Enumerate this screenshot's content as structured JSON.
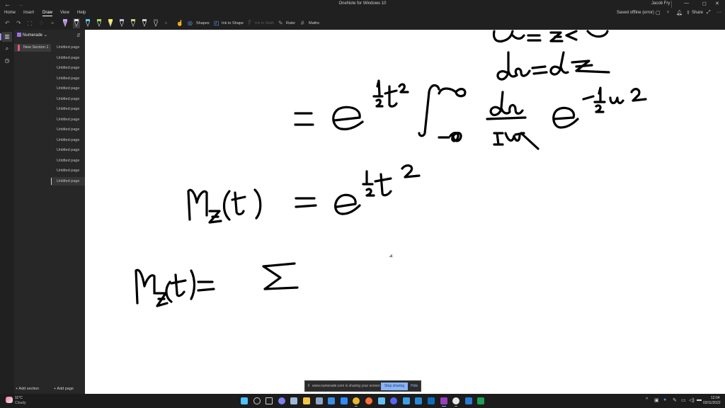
{
  "window": {
    "title": "OneNote for Windows 10",
    "user": "Jacob Fry",
    "back_icon": "←",
    "minimize": "—",
    "maximize": "◻",
    "close": "✕"
  },
  "ribbon": {
    "tabs": [
      "Home",
      "Insert",
      "Draw",
      "View",
      "Help"
    ],
    "active_tab": "Draw",
    "status": "Saved offline (error)",
    "share_label": "Share",
    "more": "···"
  },
  "toolbar": {
    "undo": "↶",
    "redo": "↷",
    "pens": [
      {
        "name": "pen-purple",
        "cap": "#c9a0ff",
        "tip": "#b07ad6"
      },
      {
        "name": "pen-black-selected",
        "cap": "#e6e6e6",
        "tip": "#111111"
      },
      {
        "name": "pen-cyan",
        "cap": "#5bc8f5",
        "tip": "#111111"
      },
      {
        "name": "pen-green",
        "cap": "#9be15a",
        "tip": "#111111"
      },
      {
        "name": "highlighter-yellow",
        "cap": "#f3f15a",
        "tip": "#f3f15a"
      },
      {
        "name": "pen-lavender",
        "cap": "#c8b4f0",
        "tip": "#111111"
      },
      {
        "name": "pen-lime",
        "cap": "#b8d98a",
        "tip": "#111111"
      },
      {
        "name": "pen-gray",
        "cap": "#cfcfcf",
        "tip": "#111111"
      },
      {
        "name": "pen-black",
        "cap": "#555555",
        "tip": "#111111"
      }
    ],
    "add_pen": "+",
    "shapes_label": "Shapes",
    "ink_to_shape_label": "Ink to Shape",
    "ink_to_math_label": "Ink to Math",
    "ruler_label": "Ruler",
    "maths_label": "Maths"
  },
  "notebook": {
    "name": "Numerade",
    "sections": [
      {
        "label": "New Section 1",
        "color": "#e8557a"
      }
    ],
    "add_section_label": "+ Add section",
    "pages": [
      "Untitled page",
      "Untitled page",
      "Untitled page",
      "Untitled page",
      "Untitled page",
      "Untitled page",
      "Untitled page",
      "Untitled page",
      "Untitled page",
      "Untitled page",
      "Untitled page",
      "Untitled page",
      "Untitled page",
      "Untitled page"
    ],
    "active_page_index": 13,
    "add_page_label": "+ Add page"
  },
  "canvas": {
    "handwriting": [
      "u = z − t",
      "du = dz",
      "= e^(½t²) ∫_{−∞}^{∞} du/√(2π) e^(−½u²)",
      "M_z(t) = e^(½t²)",
      "M_z(t) = Σ"
    ]
  },
  "sharing": {
    "message": "www.numerade.com is sharing your screen.",
    "stop_label": "Stop sharing",
    "hide_label": "Hide"
  },
  "taskbar": {
    "weather_temp": "11°C",
    "weather_condition": "Cloudy",
    "apps": [
      {
        "name": "start",
        "color": "#4cc2ff"
      },
      {
        "name": "search",
        "color": "#cfcfcf"
      },
      {
        "name": "task-view",
        "color": "#cfcfcf"
      },
      {
        "name": "teams-chat",
        "color": "#7b83eb"
      },
      {
        "name": "settings",
        "color": "#9fb8d9"
      },
      {
        "name": "file-explorer",
        "color": "#f4c542"
      },
      {
        "name": "photos",
        "color": "#8fa6c9"
      },
      {
        "name": "azure-data",
        "color": "#3a8ee6"
      },
      {
        "name": "zoom",
        "color": "#2d8cff"
      },
      {
        "name": "chrome",
        "color": "#e8b82e"
      },
      {
        "name": "firefox",
        "color": "#ff7139"
      },
      {
        "name": "steam",
        "color": "#66c0f4"
      },
      {
        "name": "discord",
        "color": "#5865f2"
      },
      {
        "name": "store",
        "color": "#3ba0e6"
      },
      {
        "name": "mail",
        "color": "#2b88d8"
      },
      {
        "name": "outlook",
        "color": "#0f6cbd"
      },
      {
        "name": "onenote",
        "color": "#9a3ebd"
      },
      {
        "name": "edge-beta",
        "color": "#e6e6e6"
      },
      {
        "name": "word",
        "color": "#2b7cd3"
      },
      {
        "name": "excel",
        "color": "#1f9d55"
      }
    ],
    "tray_chevron": "^",
    "time": "12:04",
    "date": "03/11/2022"
  }
}
